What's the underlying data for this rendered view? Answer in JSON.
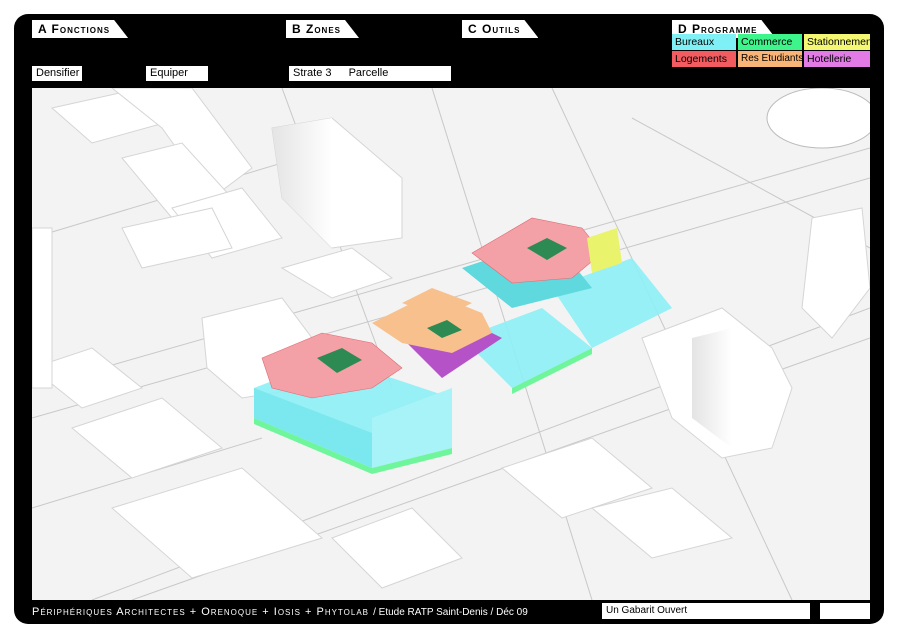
{
  "tabs": {
    "a": "A Fonctions",
    "b": "B Zones",
    "c": "C Outils",
    "d": "D Programme"
  },
  "fields": {
    "densifier": "Densifier",
    "equiper": "Equiper",
    "strate": "Strate 3",
    "parcelle": "Parcelle"
  },
  "legend": {
    "bureaux": "Bureaux",
    "commerce": "Commerce",
    "stationnement": "Stationnement",
    "logements": "Logements",
    "res_etudiants": "Res Etudiants",
    "hotellerie": "Hotellerie"
  },
  "colors": {
    "bureaux": "#7ff1f6",
    "commerce": "#3df58a",
    "stationnement": "#f3f771",
    "logements": "#f25b5f",
    "res_etudiants": "#f8b577",
    "hotellerie": "#e27be6"
  },
  "footer": {
    "credits": "Périphériques Architectes + Orenoque + Iosis + Phytolab",
    "study": "/ Etude RATP Saint-Denis / Déc 09",
    "title": "Un Gabarit Ouvert",
    "extra": ""
  }
}
